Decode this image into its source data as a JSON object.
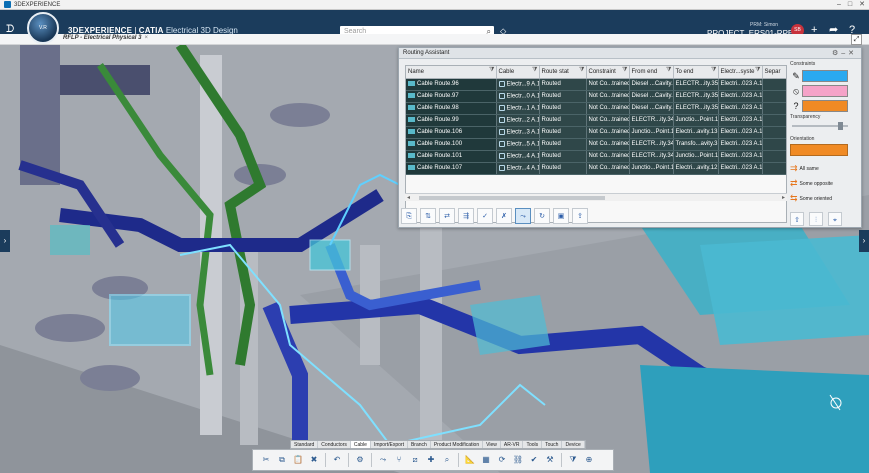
{
  "window": {
    "title": "3DEXPERIENCE",
    "controls": [
      "–",
      "□",
      "✕"
    ]
  },
  "topbar": {
    "brand_main": "3DEXPERIENCE",
    "brand_sep": " | ",
    "brand_product": "CATIA",
    "brand_app": " Electrical 3D Design",
    "compass_label": "V.R",
    "search_placeholder": "Search",
    "prm_label": "PRM: Simon",
    "project": "PROJECT_ERS01-RPE ▾",
    "avatar_initials": "SB"
  },
  "tab": {
    "label": "RFLP - Electrical Physical 3",
    "close": "×"
  },
  "routing_assistant": {
    "title": "Routing Assistant",
    "columns": [
      "Name",
      "Cable",
      "Route stat",
      "Constraint",
      "From end",
      "To end",
      "Electr...syste",
      "Separ"
    ],
    "rows": [
      [
        "Cable Route.96",
        "Electr...9 A.1",
        "Routed",
        "Not Co...trained",
        "Diesel ...Cavity.2",
        "ELECTR...ity.35",
        "Electri...023 A.1",
        ""
      ],
      [
        "Cable Route.97",
        "Electr...0 A.1",
        "Routed",
        "Not Co...trained",
        "Diesel ...Cavity.7",
        "ELECTR...ity.35",
        "Electri...023 A.1",
        ""
      ],
      [
        "Cable Route.98",
        "Electr...1 A.1",
        "Routed",
        "Not Co...trained",
        "Diesel ...Cavity.8",
        "ELECTR...ity.35",
        "Electri...023 A.1",
        ""
      ],
      [
        "Cable Route.99",
        "Electr...2 A.1",
        "Routed",
        "Not Co...trained",
        "ELECTR...ity.34",
        "Junctio...Point.1",
        "Electri...023 A.1",
        ""
      ],
      [
        "Cable Route.106",
        "Electr...3 A.1",
        "Routed",
        "Not Co...trained",
        "Junctio...Point.1",
        "Electri...avity.13",
        "Electri...023 A.1",
        ""
      ],
      [
        "Cable Route.100",
        "Electr...5 A.1",
        "Routed",
        "Not Co...trained",
        "ELECTR...ity.34",
        "Transfo...avity.3",
        "Electri...023 A.1",
        ""
      ],
      [
        "Cable Route.101",
        "Electr...4 A.1",
        "Routed",
        "Not Co...trained",
        "ELECTR...ity.34",
        "Junctio...Point.1",
        "Electri...023 A.1",
        ""
      ],
      [
        "Cable Route.107",
        "Electr...4 A.1",
        "Routed",
        "Not Co...trained",
        "Junctio...Point.1",
        "Electri...avity.12",
        "Electri...023 A.1",
        ""
      ]
    ],
    "side": {
      "constraints_label": "Constraints",
      "constraint_colors": [
        "#2aa9f0",
        "#f5a3c8",
        "#f08a24"
      ],
      "transparency_label": "Transparency",
      "transparency_value": 0.9,
      "orientation_label": "Orientation",
      "orientation_color": "#f08a24",
      "options": [
        "All same",
        "Some opposite",
        "Some oriented"
      ]
    }
  },
  "tabstrip": [
    "Standard",
    "Conductors",
    "Cable",
    "Import/Export",
    "Branch",
    "Product Modification",
    "View",
    "AR-VR",
    "Tools",
    "Touch",
    "Device"
  ],
  "tabstrip_active": 2
}
